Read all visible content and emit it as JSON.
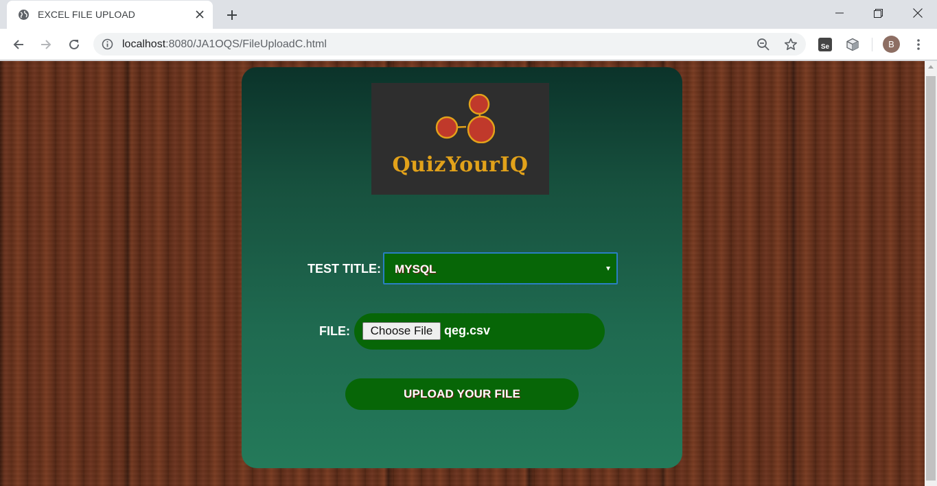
{
  "browser": {
    "tab_title": "EXCEL FILE UPLOAD",
    "url_host": "localhost",
    "url_rest": ":8080/JA1OQS/FileUploadC.html",
    "profile_initial": "B",
    "extension_se_label": "Se",
    "icons": [
      "globe-icon",
      "close-icon",
      "plus-icon",
      "minimize-icon",
      "restore-icon",
      "window-close-icon",
      "back-arrow-icon",
      "forward-arrow-icon",
      "reload-icon",
      "info-icon",
      "zoom-out-icon",
      "star-icon",
      "selenium-extension-icon",
      "cube-extension-icon",
      "kebab-menu-icon"
    ]
  },
  "page": {
    "logo_text": "QuizYourIQ",
    "test_title_label": "TEST TITLE:",
    "test_title_selected": "MYSQL",
    "file_label": "FILE:",
    "choose_file_label": "Choose File",
    "file_name": "qeg.csv",
    "upload_button_label": "UPLOAD YOUR FILE"
  },
  "colors": {
    "card_top": "#0b332a",
    "card_bottom": "#247a5a",
    "control_green": "#076607",
    "logo_gold": "#e2a21a",
    "logo_bg": "#2e2e2e",
    "wood": "#5e2c18"
  }
}
